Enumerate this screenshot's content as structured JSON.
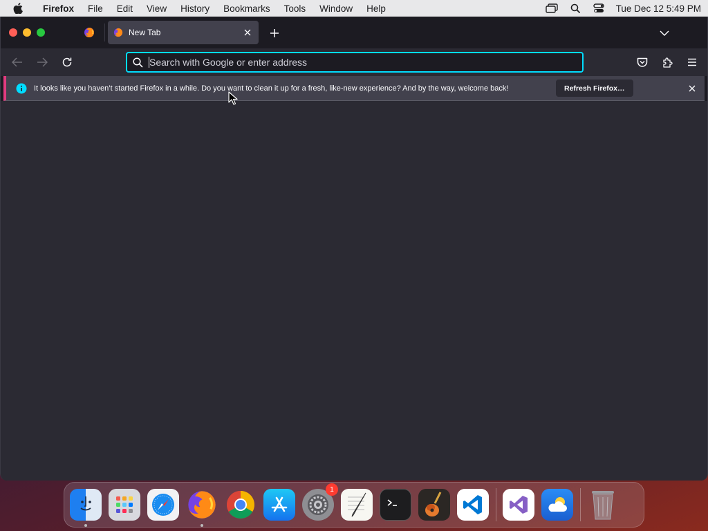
{
  "menubar": {
    "app_name": "Firefox",
    "items": [
      "File",
      "Edit",
      "View",
      "History",
      "Bookmarks",
      "Tools",
      "Window",
      "Help"
    ],
    "clock": "Tue Dec 12  5:49 PM"
  },
  "tabs": {
    "active_title": "New Tab"
  },
  "urlbar": {
    "placeholder": "Search with Google or enter address",
    "value": ""
  },
  "notification": {
    "message": "It looks like you haven’t started Firefox in a while. Do you want to clean it up for a fresh, like-new experience? And by the way, welcome back!",
    "button_label": "Refresh Firefox…"
  },
  "dock": {
    "apps": [
      "Finder",
      "Launchpad",
      "Safari",
      "Firefox",
      "Google Chrome",
      "App Store",
      "System Settings",
      "TextEdit",
      "Terminal",
      "GarageBand",
      "Visual Studio Code",
      "Visual Studio",
      "Weather",
      "Trash"
    ],
    "system_settings_badge": "1"
  },
  "colors": {
    "accent_focus": "#00ddff",
    "notification_stripe": "#e23b7f",
    "toolbar_bg": "#2b2a33",
    "tabstrip_bg": "#1c1b22"
  }
}
